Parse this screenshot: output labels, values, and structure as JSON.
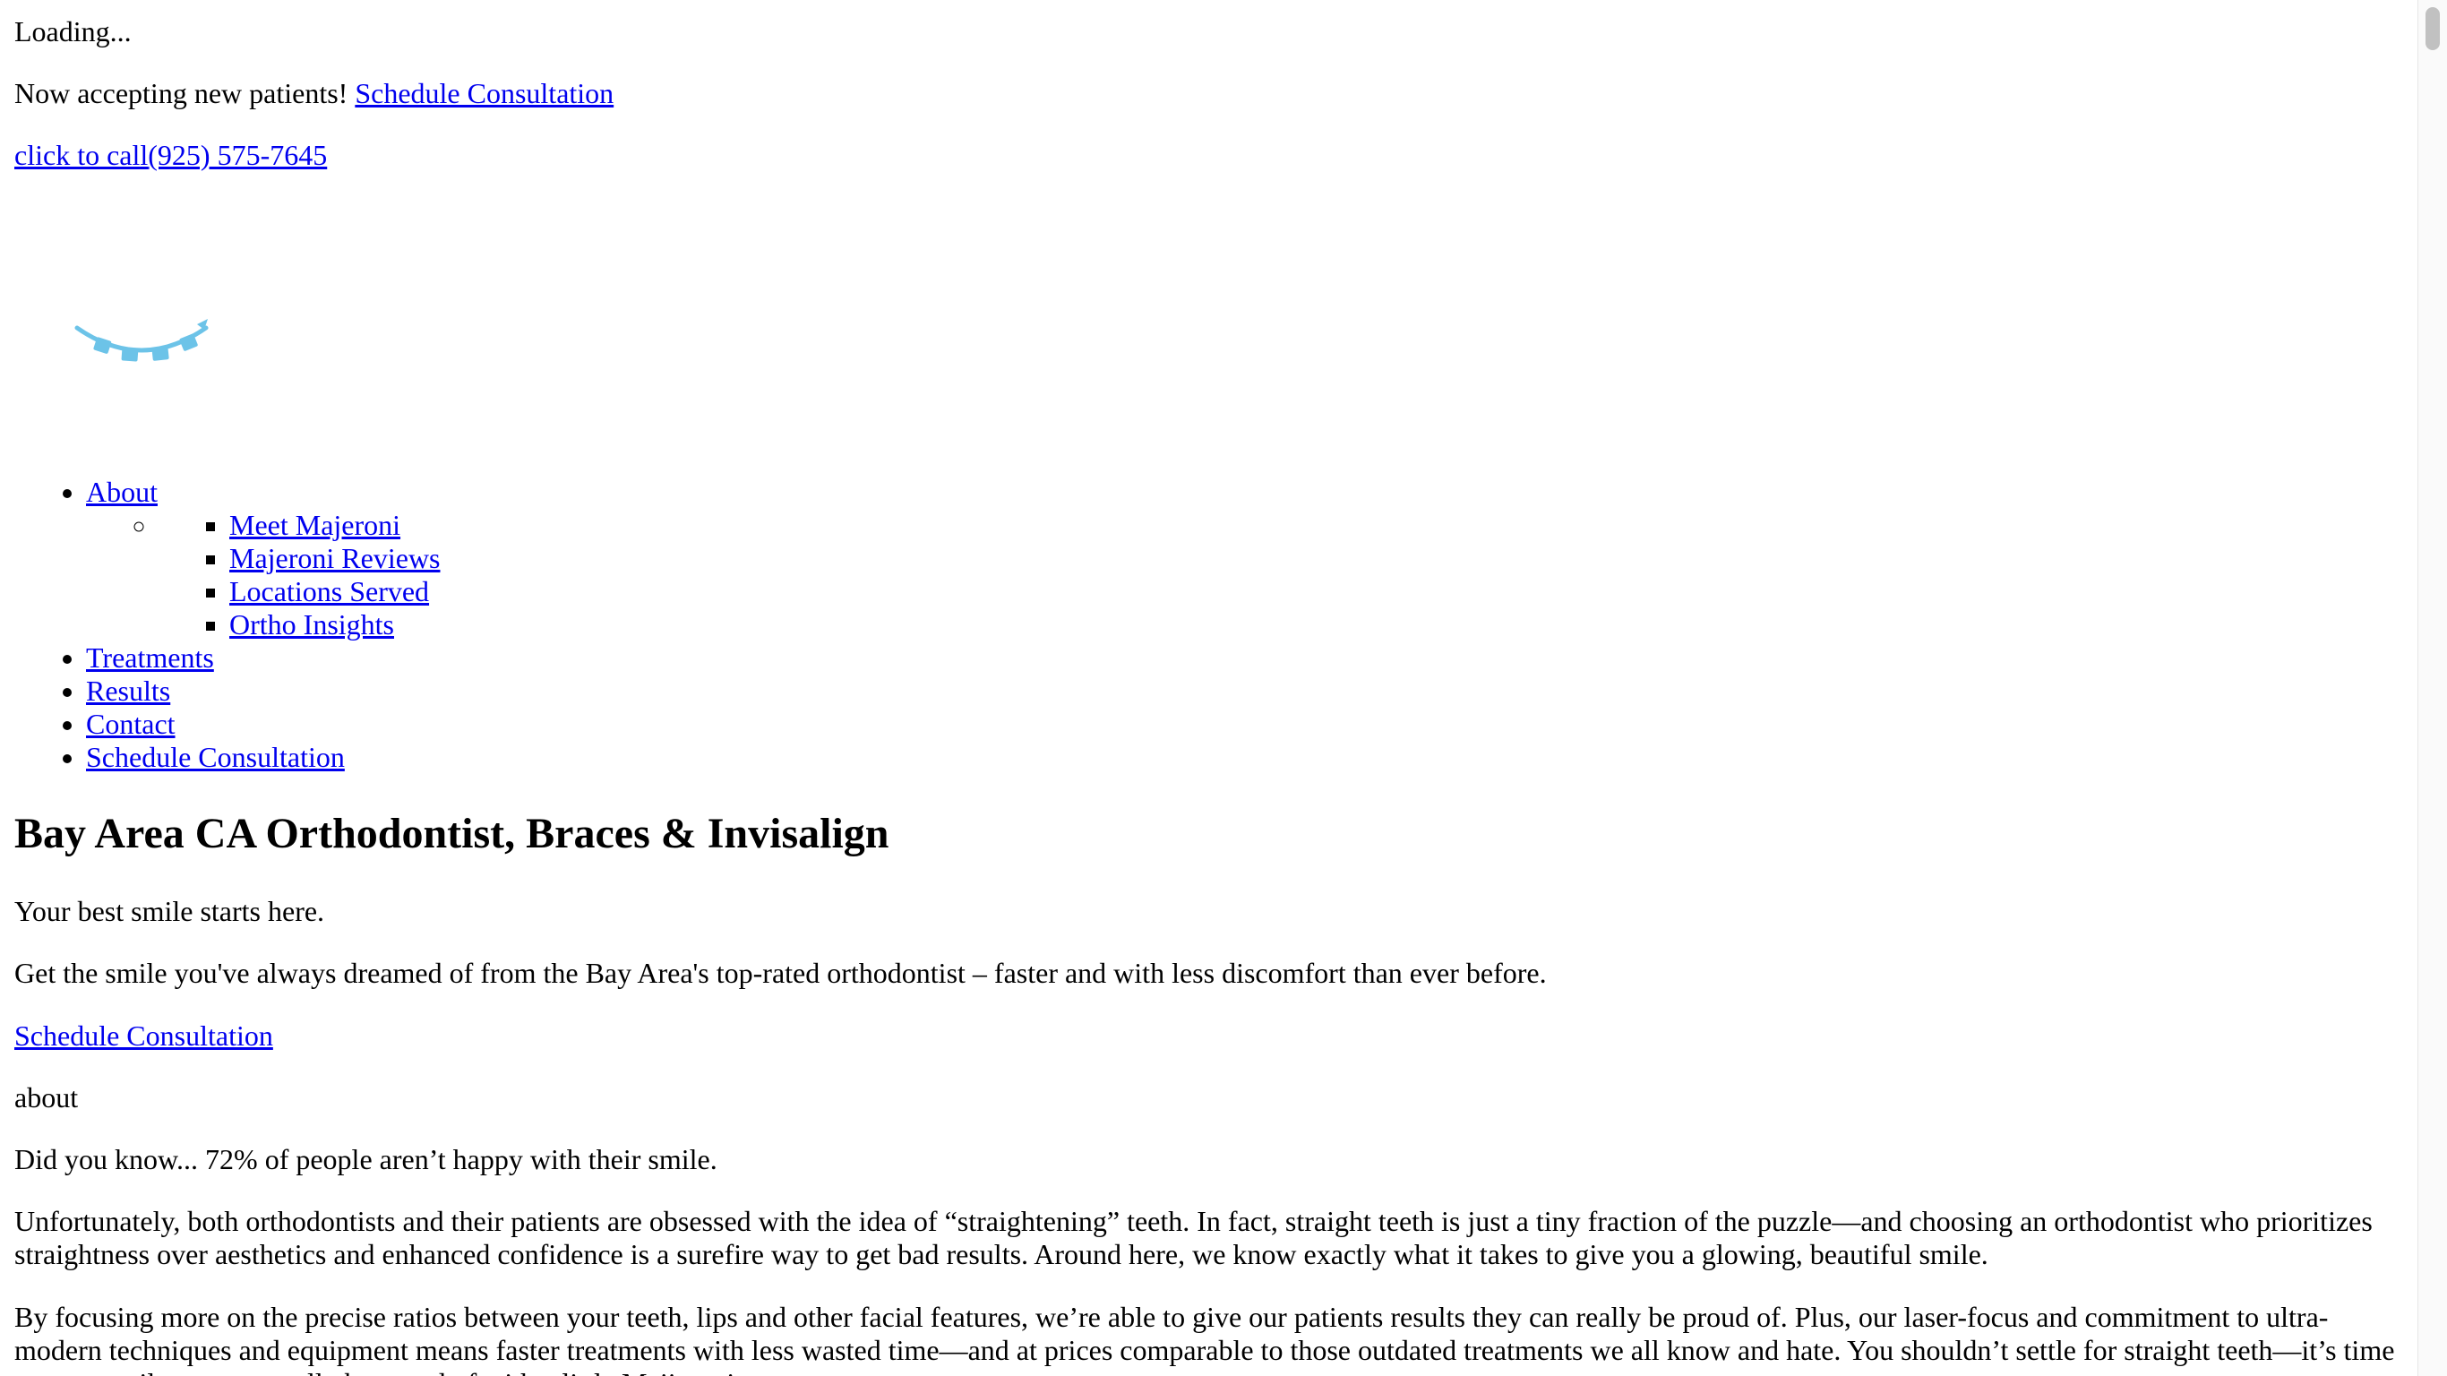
{
  "loading_text": "Loading...",
  "banner": {
    "text": "Now accepting new patients! ",
    "link_label": "Schedule Consultation"
  },
  "call": {
    "label": "click to call",
    "phone": "(925) 575-7645"
  },
  "logo": {
    "icon": "braces-smile-logo",
    "color": "#6cc3e8"
  },
  "nav": {
    "about": "About",
    "about_submenu": [
      "Meet Majeroni",
      "Majeroni Reviews",
      "Locations Served",
      "Ortho Insights"
    ],
    "treatments": "Treatments",
    "results": "Results",
    "contact": "Contact",
    "schedule": "Schedule Consultation"
  },
  "hero": {
    "title": "Bay Area CA Orthodontist, Braces & Invisalign",
    "tagline": "Your best smile starts here.",
    "lead": "Get the smile you've always dreamed of from the Bay Area's top-rated orthodontist – faster and with less discomfort than ever before.",
    "cta_label": "Schedule Consultation"
  },
  "about": {
    "label": "about",
    "did_you_know": "Did you know... 72% of people aren’t happy with their smile.",
    "paragraph1": "Unfortunately, both orthodontists and their patients are obsessed with the idea of “straightening” teeth. In fact, straight teeth is just a tiny fraction of the puzzle—and choosing an orthodontist who prioritizes straightness over aesthetics and enhanced confidence is a surefire way to get bad results. Around here, we know exactly what it takes to give you a glowing, beautiful smile.",
    "paragraph2": "By focusing more on the precise ratios between your teeth, lips and other facial features, we’re able to give our patients results they can really be proud of. Plus, our laser-focus and commitment to ultra-modern techniques and equipment means faster treatments with less wasted time—and at prices comparable to those outdated treatments we all know and hate. You shouldn’t settle for straight teeth—it’s time to get a smile you can really be proud of with a little Majjeroni"
  }
}
